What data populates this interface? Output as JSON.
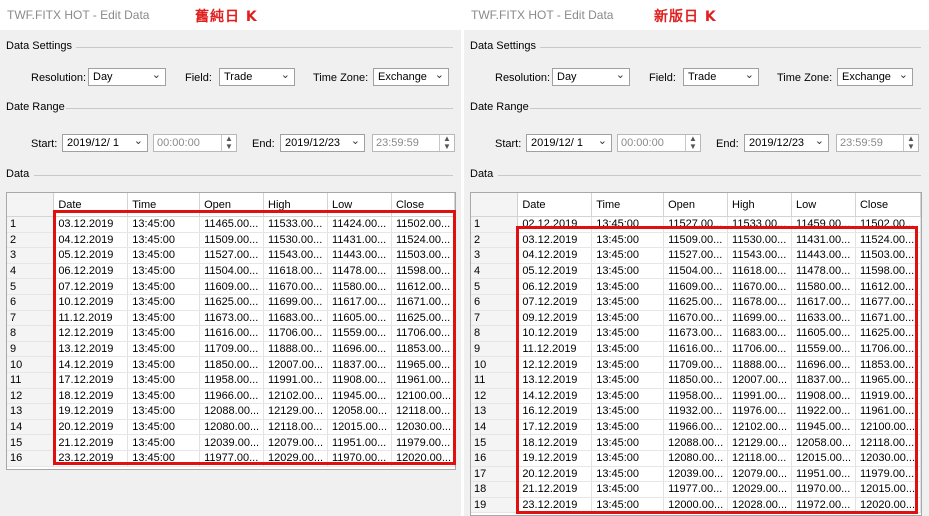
{
  "left": {
    "window_title": "TWF.FITX HOT - Edit Data",
    "caption": "舊純日 K",
    "settings_group": "Data Settings",
    "resolution_label": "Resolution:",
    "resolution_value": "Day",
    "field_label": "Field:",
    "field_value": "Trade",
    "timezone_label": "Time Zone:",
    "timezone_value": "Exchange",
    "range_group": "Date Range",
    "start_label": "Start:",
    "start_date": "2019/12/ 1",
    "start_time": "00:00:00",
    "end_label": "End:",
    "end_date": "2019/12/23",
    "end_time": "23:59:59",
    "data_group": "Data",
    "columns": [
      "Date",
      "Time",
      "Open",
      "High",
      "Low",
      "Close"
    ],
    "rows": [
      [
        "1",
        "03.12.2019",
        "13:45:00",
        "11465.00...",
        "11533.00...",
        "11424.00...",
        "11502.00..."
      ],
      [
        "2",
        "04.12.2019",
        "13:45:00",
        "11509.00...",
        "11530.00...",
        "11431.00...",
        "11524.00..."
      ],
      [
        "3",
        "05.12.2019",
        "13:45:00",
        "11527.00...",
        "11543.00...",
        "11443.00...",
        "11503.00..."
      ],
      [
        "4",
        "06.12.2019",
        "13:45:00",
        "11504.00...",
        "11618.00...",
        "11478.00...",
        "11598.00..."
      ],
      [
        "5",
        "07.12.2019",
        "13:45:00",
        "11609.00...",
        "11670.00...",
        "11580.00...",
        "11612.00..."
      ],
      [
        "6",
        "10.12.2019",
        "13:45:00",
        "11625.00...",
        "11699.00...",
        "11617.00...",
        "11671.00..."
      ],
      [
        "7",
        "11.12.2019",
        "13:45:00",
        "11673.00...",
        "11683.00...",
        "11605.00...",
        "11625.00..."
      ],
      [
        "8",
        "12.12.2019",
        "13:45:00",
        "11616.00...",
        "11706.00...",
        "11559.00...",
        "11706.00..."
      ],
      [
        "9",
        "13.12.2019",
        "13:45:00",
        "11709.00...",
        "11888.00...",
        "11696.00...",
        "11853.00..."
      ],
      [
        "10",
        "14.12.2019",
        "13:45:00",
        "11850.00...",
        "12007.00...",
        "11837.00...",
        "11965.00..."
      ],
      [
        "11",
        "17.12.2019",
        "13:45:00",
        "11958.00...",
        "11991.00...",
        "11908.00...",
        "11961.00..."
      ],
      [
        "12",
        "18.12.2019",
        "13:45:00",
        "11966.00...",
        "12102.00...",
        "11945.00...",
        "12100.00..."
      ],
      [
        "13",
        "19.12.2019",
        "13:45:00",
        "12088.00...",
        "12129.00...",
        "12058.00...",
        "12118.00..."
      ],
      [
        "14",
        "20.12.2019",
        "13:45:00",
        "12080.00...",
        "12118.00...",
        "12015.00...",
        "12030.00..."
      ],
      [
        "15",
        "21.12.2019",
        "13:45:00",
        "12039.00...",
        "12079.00...",
        "11951.00...",
        "11979.00..."
      ],
      [
        "16",
        "23.12.2019",
        "13:45:00",
        "11977.00...",
        "12029.00...",
        "11970.00...",
        "12020.00..."
      ]
    ]
  },
  "right": {
    "window_title": "TWF.FITX HOT - Edit Data",
    "caption": "新版日 K",
    "settings_group": "Data Settings",
    "resolution_label": "Resolution:",
    "resolution_value": "Day",
    "field_label": "Field:",
    "field_value": "Trade",
    "timezone_label": "Time Zone:",
    "timezone_value": "Exchange",
    "range_group": "Date Range",
    "start_label": "Start:",
    "start_date": "2019/12/ 1",
    "start_time": "00:00:00",
    "end_label": "End:",
    "end_date": "2019/12/23",
    "end_time": "23:59:59",
    "data_group": "Data",
    "columns": [
      "Date",
      "Time",
      "Open",
      "High",
      "Low",
      "Close"
    ],
    "rows": [
      [
        "1",
        "02.12.2019",
        "13:45:00",
        "11527.00...",
        "11533.00...",
        "11459.00...",
        "11502.00..."
      ],
      [
        "2",
        "03.12.2019",
        "13:45:00",
        "11509.00...",
        "11530.00...",
        "11431.00...",
        "11524.00..."
      ],
      [
        "3",
        "04.12.2019",
        "13:45:00",
        "11527.00...",
        "11543.00...",
        "11443.00...",
        "11503.00..."
      ],
      [
        "4",
        "05.12.2019",
        "13:45:00",
        "11504.00...",
        "11618.00...",
        "11478.00...",
        "11598.00..."
      ],
      [
        "5",
        "06.12.2019",
        "13:45:00",
        "11609.00...",
        "11670.00...",
        "11580.00...",
        "11612.00..."
      ],
      [
        "6",
        "07.12.2019",
        "13:45:00",
        "11625.00...",
        "11678.00...",
        "11617.00...",
        "11677.00..."
      ],
      [
        "7",
        "09.12.2019",
        "13:45:00",
        "11670.00...",
        "11699.00...",
        "11633.00...",
        "11671.00..."
      ],
      [
        "8",
        "10.12.2019",
        "13:45:00",
        "11673.00...",
        "11683.00...",
        "11605.00...",
        "11625.00..."
      ],
      [
        "9",
        "11.12.2019",
        "13:45:00",
        "11616.00...",
        "11706.00...",
        "11559.00...",
        "11706.00..."
      ],
      [
        "10",
        "12.12.2019",
        "13:45:00",
        "11709.00...",
        "11888.00...",
        "11696.00...",
        "11853.00..."
      ],
      [
        "11",
        "13.12.2019",
        "13:45:00",
        "11850.00...",
        "12007.00...",
        "11837.00...",
        "11965.00..."
      ],
      [
        "12",
        "14.12.2019",
        "13:45:00",
        "11958.00...",
        "11991.00...",
        "11908.00...",
        "11919.00..."
      ],
      [
        "13",
        "16.12.2019",
        "13:45:00",
        "11932.00...",
        "11976.00...",
        "11922.00...",
        "11961.00..."
      ],
      [
        "14",
        "17.12.2019",
        "13:45:00",
        "11966.00...",
        "12102.00...",
        "11945.00...",
        "12100.00..."
      ],
      [
        "15",
        "18.12.2019",
        "13:45:00",
        "12088.00...",
        "12129.00...",
        "12058.00...",
        "12118.00..."
      ],
      [
        "16",
        "19.12.2019",
        "13:45:00",
        "12080.00...",
        "12118.00...",
        "12015.00...",
        "12030.00..."
      ],
      [
        "17",
        "20.12.2019",
        "13:45:00",
        "12039.00...",
        "12079.00...",
        "11951.00...",
        "11979.00..."
      ],
      [
        "18",
        "21.12.2019",
        "13:45:00",
        "11977.00...",
        "12029.00...",
        "11970.00...",
        "12015.00..."
      ],
      [
        "19",
        "23.12.2019",
        "13:45:00",
        "12000.00...",
        "12028.00...",
        "11972.00...",
        "12020.00..."
      ]
    ]
  },
  "colors": {
    "highlight_box": "#e01010",
    "caption_text": "#e02020"
  },
  "icons": {
    "dropdown": "chevron-down-icon",
    "spinner": "spin-updown-icon"
  }
}
